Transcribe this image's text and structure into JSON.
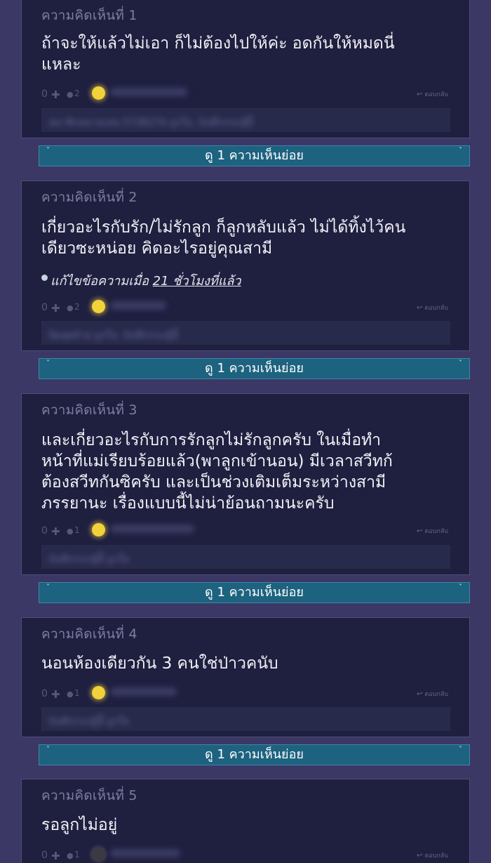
{
  "comments": [
    {
      "label": "ความคิดเห็นที่ 1",
      "text": "ถ้าจะให้แล้วไม่เอา ก็ไม่ต้องไปให้ค่ะ อดกันให้หมดนี่\nแหละ",
      "votes": "0",
      "emotions": "2",
      "reply_label": "ตอบกลับ",
      "sub_preview": "สมาชิกหมายเลข 5738274 ถูกใจ, บันทึกกระทู้นี้",
      "expand_label": "ดู 1 ความเห็นย่อย"
    },
    {
      "label": "ความคิดเห็นที่ 2",
      "text": "เกี่ยวอะไรกับรัก/ไม่รักลูก ก็ลูกหลับแล้ว ไม่ได้ทิ้งไว้คน\nเดียวซะหน่อย คิดอะไรอยู่คุณสามี",
      "edit_note": "แก้ไขข้อความเมื่อ",
      "edit_time": "21 ชั่วโมงที่แล้ว",
      "votes": "0",
      "emotions": "2",
      "reply_label": "ตอบกลับ",
      "sub_preview": "ปิดสุดท้าย ถูกใจ, บันทึกกระทู้นี้",
      "expand_label": "ดู 1 ความเห็นย่อย"
    },
    {
      "label": "ความคิดเห็นที่ 3",
      "text": "และเกี่ยวอะไรกับการรักลูกไม่รักลูกครับ ในเมื่อทำ\nหน้าที่แม่เรียบร้อยแล้ว(พาลูกเข้านอน) มีเวลาสวีทก้\nต้องสวีทกันซิครับ  และเป็นช่วงเติมเต็มระหว่างสามี\nภรรยานะ เรื่องแบบนี้ไม่น่าย้อนถามนะครับ",
      "votes": "0",
      "emotions": "1",
      "reply_label": "ตอบกลับ",
      "sub_preview": "บันทึกกระทู้นี้ ถูกใจ",
      "expand_label": "ดู 1 ความเห็นย่อย"
    },
    {
      "label": "ความคิดเห็นที่ 4",
      "text": "นอนห้องเดียวกัน 3 คนใช่ป่าวคนับ",
      "votes": "0",
      "emotions": "1",
      "reply_label": "ตอบกลับ",
      "sub_preview": "บันทึกกระทู้นี้ ถูกใจ",
      "expand_label": "ดู 1 ความเห็นย่อย"
    },
    {
      "label": "ความคิดเห็นที่ 5",
      "text": "รอลูกไม่อยู่",
      "votes": "0",
      "emotions": "1",
      "reply_label": "ตอบกลับ"
    }
  ],
  "icons": {
    "plus": "plus-icon",
    "emotion": "emotion-icon",
    "reply": "reply-icon",
    "chevron": "chevron-down-icon"
  },
  "colors": {
    "page_bg": "#3b3865",
    "card_bg": "#1f1f40",
    "expand_bar_bg": "#1d627f",
    "avatar": "#f2d23a"
  }
}
